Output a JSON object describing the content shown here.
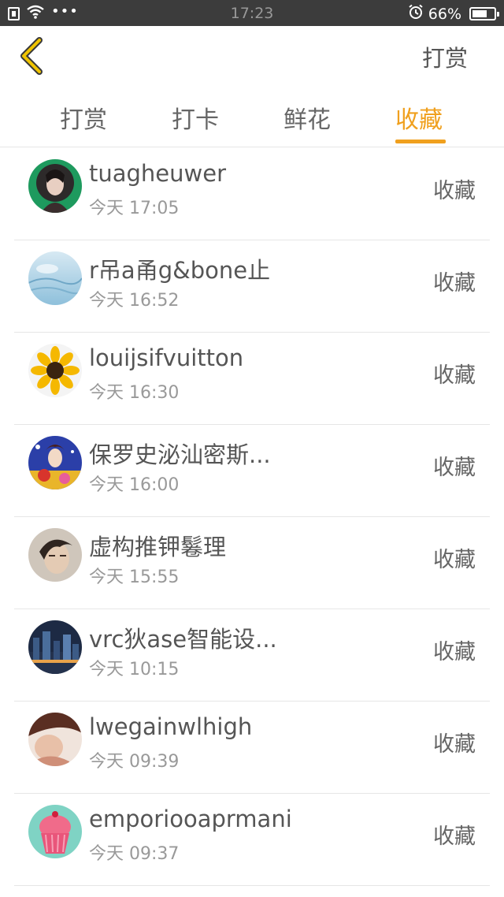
{
  "status_bar": {
    "time": "17:23",
    "battery": "66%",
    "icons": [
      "sim-icon",
      "wifi-icon",
      "more-dots-icon",
      "alarm-icon",
      "battery-icon"
    ]
  },
  "header": {
    "back_icon": "chevron-left-icon",
    "action_label": "打赏"
  },
  "tabs": [
    {
      "label": "打赏",
      "active": false
    },
    {
      "label": "打卡",
      "active": false
    },
    {
      "label": "鲜花",
      "active": false
    },
    {
      "label": "收藏",
      "active": true
    }
  ],
  "colors": {
    "accent": "#f0a01e",
    "status_bar": "#3c3c3c",
    "back_icon": "#f0c400",
    "divider": "#e6e6e6"
  },
  "list": [
    {
      "name": "tuagheuwer",
      "time": "今天 17:05",
      "action": "收藏",
      "avatar": "anime-portrait-avatar"
    },
    {
      "name": "r吊a甬g&bone止",
      "time": "今天 16:52",
      "action": "收藏",
      "avatar": "sky-avatar"
    },
    {
      "name": "louijsifvuitton",
      "time": "今天 16:30",
      "action": "收藏",
      "avatar": "sunflower-avatar"
    },
    {
      "name": "保罗史泌汕密斯...",
      "time": "今天 16:00",
      "action": "收藏",
      "avatar": "illustration-avatar"
    },
    {
      "name": "虚构推钾鬈理",
      "time": "今天 15:55",
      "action": "收藏",
      "avatar": "portrait-avatar"
    },
    {
      "name": "vrc狄ase智能设...",
      "time": "今天 10:15",
      "action": "收藏",
      "avatar": "city-night-avatar"
    },
    {
      "name": "lwegainwlhigh",
      "time": "今天 09:39",
      "action": "收藏",
      "avatar": "face-avatar"
    },
    {
      "name": "emporiooaprmani",
      "time": "今天 09:37",
      "action": "收藏",
      "avatar": "cupcake-avatar"
    }
  ]
}
